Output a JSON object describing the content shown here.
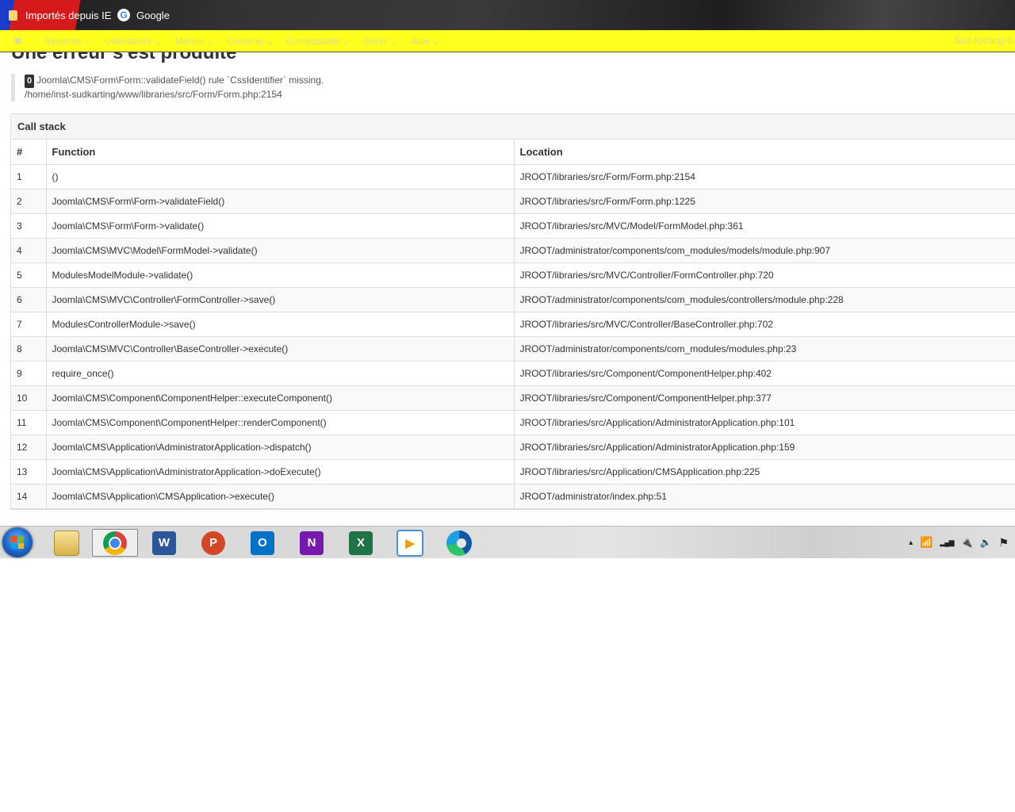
{
  "bookmarks": {
    "items": [
      {
        "label": "Importés depuis IE"
      },
      {
        "label": "Google"
      }
    ]
  },
  "navbar": {
    "logo_glyph": "✖",
    "items": [
      {
        "label": "Système ⌄"
      },
      {
        "label": "Utilisateurs ⌄"
      },
      {
        "label": "Menus ⌄"
      },
      {
        "label": "Contenu ⌄"
      },
      {
        "label": "Composants ⌄"
      },
      {
        "label": "Gérer ⌄"
      },
      {
        "label": "Aide ⌄"
      }
    ],
    "site_label": "Sud Karting ⧉"
  },
  "page": {
    "title": "Une erreur s'est produite"
  },
  "error": {
    "code": "0",
    "message": "Joomla\\CMS\\Form\\Form::validateField() rule `CssIdentifier` missing.",
    "path": "/home/inst-sudkarting/www/libraries/src/Form/Form.php:2154"
  },
  "callstack": {
    "caption": "Call stack",
    "headers": {
      "num": "#",
      "function": "Function",
      "location": "Location"
    },
    "rows": [
      {
        "num": "1",
        "function": "()",
        "location": "JROOT/libraries/src/Form/Form.php:2154"
      },
      {
        "num": "2",
        "function": "Joomla\\CMS\\Form\\Form->validateField()",
        "location": "JROOT/libraries/src/Form/Form.php:1225"
      },
      {
        "num": "3",
        "function": "Joomla\\CMS\\Form\\Form->validate()",
        "location": "JROOT/libraries/src/MVC/Model/FormModel.php:361"
      },
      {
        "num": "4",
        "function": "Joomla\\CMS\\MVC\\Model\\FormModel->validate()",
        "location": "JROOT/administrator/components/com_modules/models/module.php:907"
      },
      {
        "num": "5",
        "function": "ModulesModelModule->validate()",
        "location": "JROOT/libraries/src/MVC/Controller/FormController.php:720"
      },
      {
        "num": "6",
        "function": "Joomla\\CMS\\MVC\\Controller\\FormController->save()",
        "location": "JROOT/administrator/components/com_modules/controllers/module.php:228"
      },
      {
        "num": "7",
        "function": "ModulesControllerModule->save()",
        "location": "JROOT/libraries/src/MVC/Controller/BaseController.php:702"
      },
      {
        "num": "8",
        "function": "Joomla\\CMS\\MVC\\Controller\\BaseController->execute()",
        "location": "JROOT/administrator/components/com_modules/modules.php:23"
      },
      {
        "num": "9",
        "function": "require_once()",
        "location": "JROOT/libraries/src/Component/ComponentHelper.php:402"
      },
      {
        "num": "10",
        "function": "Joomla\\CMS\\Component\\ComponentHelper::executeComponent()",
        "location": "JROOT/libraries/src/Component/ComponentHelper.php:377"
      },
      {
        "num": "11",
        "function": "Joomla\\CMS\\Component\\ComponentHelper::renderComponent()",
        "location": "JROOT/libraries/src/Application/AdministratorApplication.php:101"
      },
      {
        "num": "12",
        "function": "Joomla\\CMS\\Application\\AdministratorApplication->dispatch()",
        "location": "JROOT/libraries/src/Application/AdministratorApplication.php:159"
      },
      {
        "num": "13",
        "function": "Joomla\\CMS\\Application\\AdministratorApplication->doExecute()",
        "location": "JROOT/libraries/src/Application/CMSApplication.php:225"
      },
      {
        "num": "14",
        "function": "Joomla\\CMS\\Application\\CMSApplication->execute()",
        "location": "JROOT/administrator/index.php:51"
      }
    ]
  },
  "taskbar": {
    "apps": [
      {
        "name": "explorer-icon",
        "glyph": ""
      },
      {
        "name": "chrome-icon",
        "glyph": ""
      },
      {
        "name": "word-icon",
        "glyph": "W",
        "color": "#2b579a"
      },
      {
        "name": "powerpoint-icon",
        "glyph": "P",
        "color": "#d24726"
      },
      {
        "name": "outlook-icon",
        "glyph": "O",
        "color": "#0072c6"
      },
      {
        "name": "onenote-icon",
        "glyph": "N",
        "color": "#7719aa"
      },
      {
        "name": "excel-icon",
        "glyph": "X",
        "color": "#217346"
      },
      {
        "name": "media-player-icon",
        "glyph": "▶",
        "color": "#f39c12"
      },
      {
        "name": "edge-icon",
        "glyph": ""
      }
    ],
    "tray": {
      "up_arrow": "▴",
      "network": "📶",
      "signal": "▂▄▆",
      "power": "🔌",
      "volume": "🔈",
      "flag": "⚑"
    }
  }
}
